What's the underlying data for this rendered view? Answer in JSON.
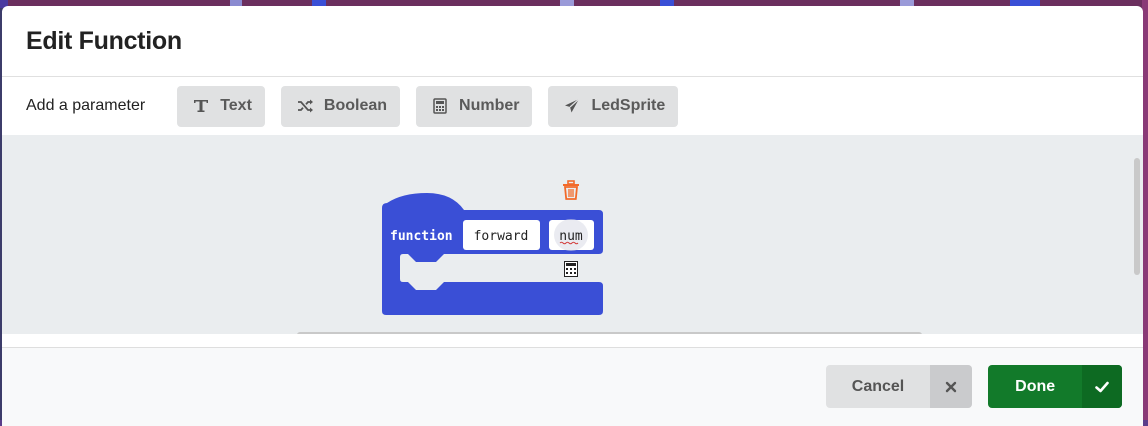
{
  "dialog": {
    "title": "Edit Function"
  },
  "param_bar": {
    "label": "Add a parameter",
    "buttons": [
      {
        "label": "Text",
        "icon": "text-cursor-icon"
      },
      {
        "label": "Boolean",
        "icon": "shuffle-icon"
      },
      {
        "label": "Number",
        "icon": "calculator-icon"
      },
      {
        "label": "LedSprite",
        "icon": "paper-plane-icon"
      }
    ]
  },
  "block": {
    "keyword": "function",
    "name": "forward",
    "param": "num",
    "param_type_icon": "calculator-icon",
    "delete_icon": "trash-icon",
    "color": "#3a4fd6"
  },
  "footer": {
    "cancel_label": "Cancel",
    "done_label": "Done"
  },
  "colors": {
    "done": "#127a2a",
    "trash": "#f26a2a",
    "workspace": "#eaedef"
  }
}
